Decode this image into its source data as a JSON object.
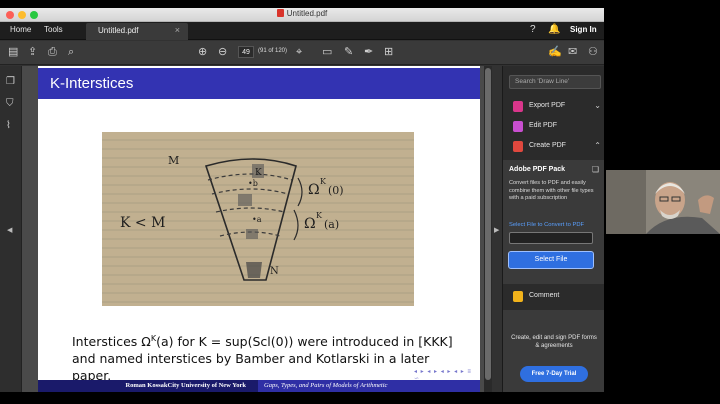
{
  "window": {
    "title": "Untitled.pdf"
  },
  "menubar": {
    "home": "Home",
    "tools": "Tools",
    "tab_label": "Untitled.pdf",
    "tab_close": "×",
    "signin": "Sign In"
  },
  "toolbar": {
    "page_number": "49",
    "page_of": "(91 of 120)"
  },
  "slide": {
    "title": "K-Interstices",
    "caption_line1": "Interstices Ω",
    "caption_sup": "K",
    "caption_line1_rest": "(a) for K = sup(Scl(0)) were introduced in [KKK]",
    "caption_line2": "and named interstices by Bamber and Kotlarski in a later paper.",
    "footer_left": "Roman KossakCity University of New York",
    "footer_right": "Gaps, Types, and Pairs of Models of Arithmetic",
    "nav_symbols": "◂ ▸ ◂ ▸ ◂ ▸ ◂ ▸ ≡ ∽"
  },
  "handwriting": {
    "m_top": "M",
    "k_less_m": "K < M",
    "omega_k_0": "Ω",
    "omega_k_0_sup": "K",
    "omega_k_0_arg": "(0)",
    "omega_k_a": "Ω",
    "omega_k_a_sup": "K",
    "omega_k_a_arg": "(a)",
    "k_label": "K",
    "dot_b": "•b",
    "dot_a": "•a",
    "n_label": "N"
  },
  "right_panel": {
    "search_placeholder": "Search 'Draw Line'",
    "export_pdf": "Export PDF",
    "edit_pdf": "Edit PDF",
    "create_pdf": "Create PDF",
    "pack_title": "Adobe PDF Pack",
    "pack_desc": "Convert files to PDF and easily combine them with other file types with a paid subscription",
    "select_label": "Select File to Convert to PDF",
    "select_button": "Select File",
    "comment": "Comment",
    "cta_text": "Create, edit and sign PDF forms & agreements",
    "cta_button": "Free 7-Day Trial"
  },
  "colors": {
    "slide_header": "#3333b2",
    "accent_blue": "#2f6fe0",
    "export_icon": "#d9368b",
    "edit_icon": "#c94fd0",
    "create_icon": "#e0483e",
    "comment_icon": "#f2b31b"
  },
  "icons": [
    "save-icon",
    "upload-icon",
    "print-icon",
    "zoom-icon",
    "prev-page-icon",
    "next-page-icon",
    "select-icon",
    "sign-icon",
    "highlight-icon",
    "share-icon",
    "help-icon",
    "bell-icon",
    "grid-icon"
  ]
}
